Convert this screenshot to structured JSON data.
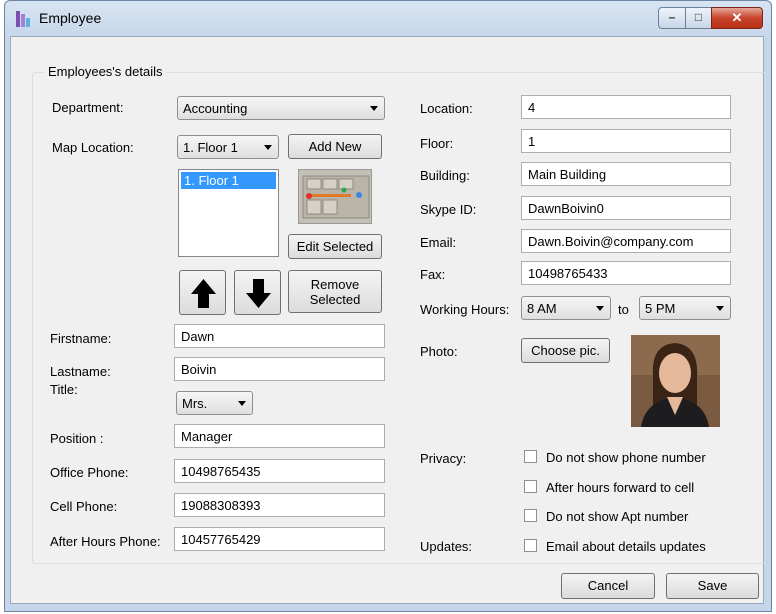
{
  "window": {
    "title": "Employee"
  },
  "group": {
    "title": "Employees's details"
  },
  "left": {
    "department": {
      "label": "Department:",
      "value": "Accounting"
    },
    "map_location": {
      "label": "Map Location:",
      "value": "1. Floor 1",
      "add_new": "Add New"
    },
    "floors_list": {
      "items": [
        "1. Floor 1"
      ]
    },
    "edit_selected": "Edit Selected",
    "remove_selected": "Remove Selected",
    "firstname": {
      "label": "Firstname:",
      "value": "Dawn"
    },
    "lastname": {
      "label": "Lastname:",
      "value": "Boivin"
    },
    "title": {
      "label": "Title:",
      "value": "Mrs."
    },
    "position": {
      "label": "Position :",
      "value": "Manager"
    },
    "office_phone": {
      "label": "Office Phone:",
      "value": "10498765435"
    },
    "cell_phone": {
      "label": "Cell Phone:",
      "value": "19088308393"
    },
    "after_hours_phone": {
      "label": "After Hours Phone:",
      "value": "10457765429"
    }
  },
  "right": {
    "location": {
      "label": "Location:",
      "value": "4"
    },
    "floor": {
      "label": "Floor:",
      "value": "1"
    },
    "building": {
      "label": "Building:",
      "value": "Main Building"
    },
    "skype": {
      "label": "Skype ID:",
      "value": "DawnBoivin0"
    },
    "email": {
      "label": "Email:",
      "value": "Dawn.Boivin@company.com"
    },
    "fax": {
      "label": "Fax:",
      "value": "10498765433"
    },
    "working_hours": {
      "label": "Working Hours:",
      "from": "8 AM",
      "to_label": "to",
      "to": "5 PM"
    },
    "photo": {
      "label": "Photo:",
      "button": "Choose pic."
    },
    "privacy": {
      "label": "Privacy:",
      "options": [
        "Do not show phone number",
        "After hours forward to cell",
        "Do not show Apt number"
      ]
    },
    "updates": {
      "label": "Updates:",
      "option": "Email about details updates"
    }
  },
  "footer": {
    "cancel": "Cancel",
    "save": "Save"
  }
}
